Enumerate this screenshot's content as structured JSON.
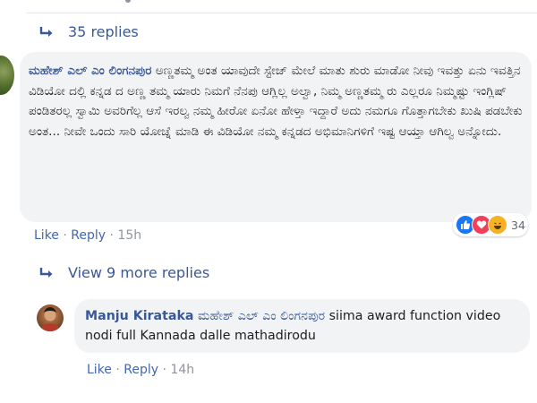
{
  "thread": {
    "replies_link": "35 replies",
    "more_replies_link": "View 9 more replies"
  },
  "comment": {
    "author": "ಮಹೇಶ್ ಎಲ್ ಎಂ ಲಿಂಗನಪುರ",
    "text": "ಅಣ್ಣತಮ್ಮ ಅಂತ ಯಾವುದೇ ಸ್ಟೇಜ್ ಮೇಲೆ ಮಾತು ಶುರು ಮಾಡೋ ನೀವು ಇವತ್ತು ಏನು ಇವತ್ತಿನ ವಿಡಿಯೋ ದಲ್ಲಿ ಕನ್ನಡ ದ ಅಣ್ಣ ತಮ್ಮ ಯಾರು ನಿಮಗೆ ನೆನಪು ಆಗ್ಲಿಲ್ಲ ಅಲ್ವಾ, ನಿಮ್ಮ ಅಣ್ಣತಮ್ಮ ರು ಎಲ್ಲರೂ ನಿಮ್ಮಷ್ಟು ಇಂಗ್ಲಿಷ್ ಪಂಡಿತರಲ್ಲ ಸ್ವಾಮಿ ಅವರಿಗೆಲ್ಲ ಆಸೆ ಇರಲ್ವ ನಮ್ಮ ಹೀರೋ ಏನೋ ಹೇಳ್ತಾ ಇದ್ದಾರೆ ಅದು ನಮಗೂ ಗೊತ್ತಾಗಬೇಕು ಖುಷಿ ಪಡಬೇಕು ಅಂತ... ನೀವೇ ಒಂದು ಸಾರಿ ಯೋಚ್ನೆ ಮಾಡಿ ಈ ವಿಡಿಯೋ ನಮ್ಮ ಕನ್ನಡದ ಅಭಿಮಾನಿಗಳಿಗೆ ಇಷ್ಟ ಆಯ್ತಾ ಆಗಿಲ್ವ ಅನ್ನೋದು.",
    "like": "Like",
    "reply": "Reply",
    "separator": "·",
    "time": "15h",
    "reaction_count": "34",
    "reaction_icons": [
      "like-icon",
      "love-icon",
      "haha-icon"
    ]
  },
  "reply": {
    "author": "Manju Kirataka",
    "mention": "ಮಹೇಶ್ ಎಲ್ ಎಂ ಲಿಂಗನಪುರ",
    "text": "siima award function video nodi full Kannada dalle mathadirodu",
    "like": "Like",
    "reply": "Reply",
    "separator": "·",
    "time": "14h"
  },
  "colors": {
    "link": "#385898",
    "action": "#4267b2",
    "muted": "#90949c",
    "bubble_bg": "#f2f3f5"
  }
}
